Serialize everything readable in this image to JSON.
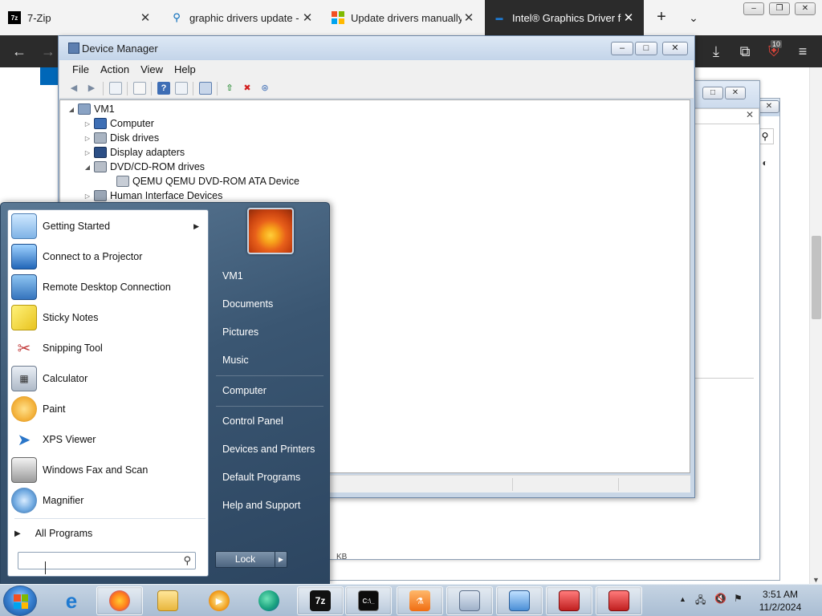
{
  "browser": {
    "tabs": [
      {
        "title": "7-Zip",
        "icon": "7zip-icon"
      },
      {
        "title": "graphic drivers update - Se",
        "icon": "search-icon"
      },
      {
        "title": "Update drivers manually in",
        "icon": "microsoft-icon"
      },
      {
        "title": "Intel® Graphics Driver for",
        "icon": "intel-icon",
        "active": true
      }
    ],
    "new_tab": "+",
    "tab_list": "⌄",
    "window_controls": [
      "–",
      "❐",
      "✕"
    ],
    "downloads_badge": "10"
  },
  "device_manager": {
    "title": "Device Manager",
    "window_controls": [
      "–",
      "□",
      "✕"
    ],
    "menu": [
      "File",
      "Action",
      "View",
      "Help"
    ],
    "tree": [
      {
        "label": "VM1",
        "level": 0,
        "expander": "◢",
        "icon": "computer-root-icon"
      },
      {
        "label": "Computer",
        "level": 1,
        "expander": "▷",
        "icon": "computer-icon"
      },
      {
        "label": "Disk drives",
        "level": 1,
        "expander": "▷",
        "icon": "disk-drive-icon"
      },
      {
        "label": "Display adapters",
        "level": 1,
        "expander": "▷",
        "icon": "display-adapter-icon"
      },
      {
        "label": "DVD/CD-ROM drives",
        "level": 1,
        "expander": "◢",
        "icon": "dvd-drive-icon"
      },
      {
        "label": "QEMU QEMU DVD-ROM ATA Device",
        "level": 2,
        "expander": "",
        "icon": "dvd-device-icon"
      },
      {
        "label": "Human Interface Devices",
        "level": 1,
        "expander": "▷",
        "icon": "hid-icon"
      }
    ]
  },
  "background_window": {
    "close_x": "✕",
    "kb_text": "KB"
  },
  "start_menu": {
    "programs": [
      {
        "label": "Getting Started",
        "icon": "getting-started-icon",
        "submenu": true
      },
      {
        "label": "Connect to a Projector",
        "icon": "projector-icon"
      },
      {
        "label": "Remote Desktop Connection",
        "icon": "remote-desktop-icon"
      },
      {
        "label": "Sticky Notes",
        "icon": "sticky-notes-icon"
      },
      {
        "label": "Snipping Tool",
        "icon": "snipping-tool-icon"
      },
      {
        "label": "Calculator",
        "icon": "calculator-icon"
      },
      {
        "label": "Paint",
        "icon": "paint-icon"
      },
      {
        "label": "XPS Viewer",
        "icon": "xps-viewer-icon"
      },
      {
        "label": "Windows Fax and Scan",
        "icon": "fax-scan-icon"
      },
      {
        "label": "Magnifier",
        "icon": "magnifier-icon"
      }
    ],
    "all_programs": "All Programs",
    "search": {
      "value": "",
      "placeholder": ""
    },
    "right_items": [
      {
        "label": "VM1"
      },
      {
        "label": "Documents"
      },
      {
        "label": "Pictures"
      },
      {
        "label": "Music"
      },
      {
        "label": "Computer"
      },
      {
        "label": "Control Panel"
      },
      {
        "label": "Devices and Printers"
      },
      {
        "label": "Default Programs"
      },
      {
        "label": "Help and Support"
      }
    ],
    "lock_label": "Lock"
  },
  "taskbar": {
    "items": [
      "internet-explorer-icon",
      "firefox-icon",
      "file-explorer-icon",
      "media-player-icon",
      "edge-icon",
      "7zip-taskbar-icon",
      "command-prompt-icon",
      "flask-app-icon",
      "drive-app-icon",
      "control-panel-icon",
      "toolbox-icon",
      "toolbox-icon-2"
    ],
    "clock": {
      "time": "3:51 AM",
      "date": "11/2/2024"
    }
  }
}
